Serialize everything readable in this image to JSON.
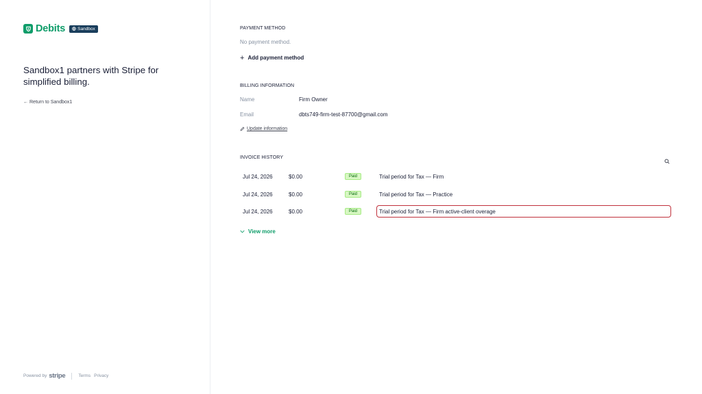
{
  "brand": {
    "name": "Debits",
    "badge": "Sandbox",
    "accent_color": "#0f9d6a"
  },
  "left": {
    "tagline": "Sandbox1 partners with Stripe for simplified billing.",
    "return_link": "Return to Sandbox1"
  },
  "footer": {
    "powered_by": "Powered by",
    "stripe": "stripe",
    "terms": "Terms",
    "privacy": "Privacy"
  },
  "payment_method": {
    "title": "PAYMENT METHOD",
    "empty_text": "No payment method.",
    "add_label": "Add payment method"
  },
  "billing": {
    "title": "BILLING INFORMATION",
    "name_label": "Name",
    "name_value": "Firm Owner",
    "email_label": "Email",
    "email_value": "dbts749-firm-test-87700@gmail.com",
    "update_label": "Update information"
  },
  "invoices": {
    "title": "INVOICE HISTORY",
    "search_icon": "search-icon",
    "rows": [
      {
        "date": "Jul 24, 2026",
        "amount": "$0.00",
        "status": "Paid",
        "description": "Trial period for Tax — Firm"
      },
      {
        "date": "Jul 24, 2026",
        "amount": "$0.00",
        "status": "Paid",
        "description": "Trial period for Tax — Practice"
      },
      {
        "date": "Jul 24, 2026",
        "amount": "$0.00",
        "status": "Paid",
        "description": "Trial period for Tax — Firm active-client overage"
      }
    ],
    "view_more": "View more",
    "highlight_color": "#c0303b",
    "paid_color": "#006908"
  }
}
